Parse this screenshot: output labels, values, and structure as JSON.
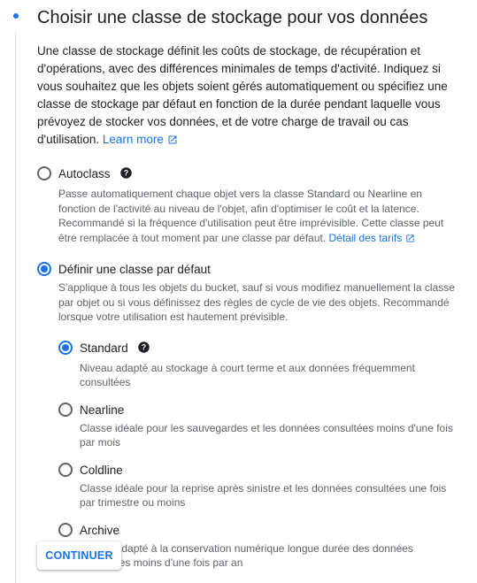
{
  "header": {
    "title": "Choisir une classe de stockage pour vos données"
  },
  "intro": {
    "text": "Une classe de stockage définit les coûts de stockage, de récupération et d'opérations, avec des différences minimales de temps d'activité. Indiquez si vous souhaitez que les objets soient gérés automatiquement ou spécifiez une classe de stockage par défaut en fonction de la durée pendant laquelle vous prévoyez de stocker vos données, et de votre charge de travail ou cas d'utilisation.",
    "link_label": "Learn more"
  },
  "options": {
    "autoclass": {
      "label": "Autoclass",
      "selected": false,
      "description": "Passe automatiquement chaque objet vers la classe Standard ou Nearline en fonction de l'activité au niveau de l'objet, afin d'optimiser le coût et la latence. Recommandé si la fréquence d'utilisation peut être imprévisible. Cette classe peut être remplacée à tout moment par une classe par défaut.",
      "link_label": "Détail des tarifs"
    },
    "default_class": {
      "label": "Définir une classe par défaut",
      "selected": true,
      "description": "S'applique à tous les objets du bucket, sauf si vous modifiez manuellement la classe par objet ou si vous définissez des règles de cycle de vie des objets. Recommandé lorsque votre utilisation est hautement prévisible."
    }
  },
  "classes": [
    {
      "label": "Standard",
      "selected": true,
      "description": "Niveau adapté au stockage à court terme et aux données fréquemment consultées"
    },
    {
      "label": "Nearline",
      "selected": false,
      "description": "Classe idéale pour les sauvegardes et les données consultées moins d'une fois par mois"
    },
    {
      "label": "Coldline",
      "selected": false,
      "description": "Classe idéale pour la reprise après sinistre et les données consultées une fois par trimestre ou moins"
    },
    {
      "label": "Archive",
      "selected": false,
      "description": "Niveau adapté à la conservation numérique longue durée des données consultées moins d'une fois par an"
    }
  ],
  "actions": {
    "continue_label": "CONTINUER"
  },
  "colors": {
    "accent": "#1a73e8",
    "text": "#202124",
    "secondary_text": "#5f6368",
    "divider": "#dadce0"
  }
}
